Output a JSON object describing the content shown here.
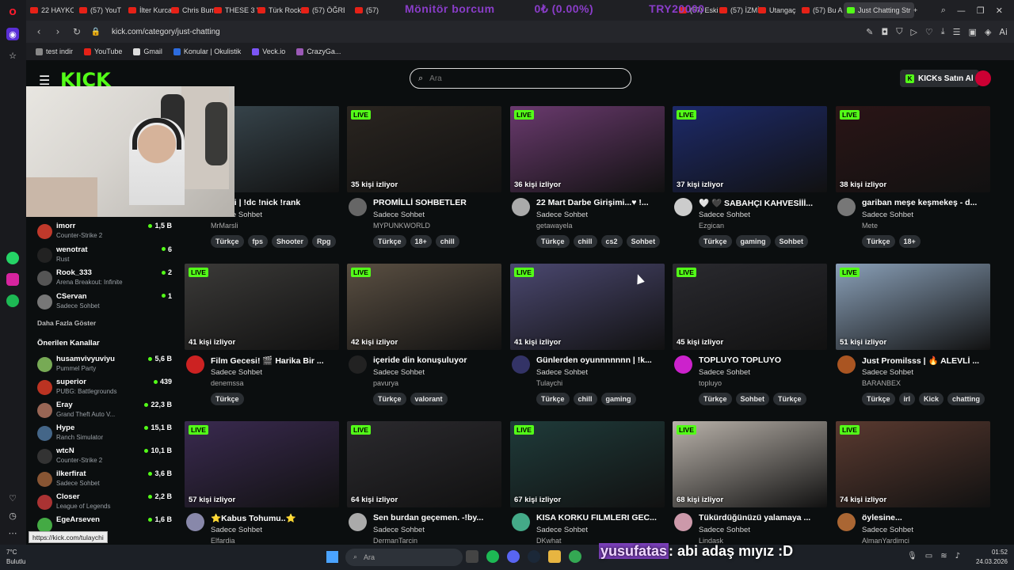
{
  "browser": {
    "tabs": [
      {
        "label": "22 HAYKO",
        "x": "38"
      },
      {
        "label": "(57) YouT",
        "x": "100"
      },
      {
        "label": "İlter Kurca",
        "x": "162"
      },
      {
        "label": "Chris Bum",
        "x": "216"
      },
      {
        "label": "THESE 3 V",
        "x": "270"
      },
      {
        "label": "Türk Rock",
        "x": "325"
      },
      {
        "label": "(57) ÖĞRE",
        "x": "380"
      },
      {
        "label": "(57)",
        "x": "448"
      },
      {
        "label": "(57) Eski S",
        "x": "857"
      },
      {
        "label": "(57) İZMİ",
        "x": "908"
      },
      {
        "label": "Utangaç",
        "x": "957"
      },
      {
        "label": "(57) Bu A",
        "x": "1012"
      },
      {
        "label": "Just Chatting Str",
        "x": "1065"
      }
    ],
    "ticker": {
      "label": "Mönitör borcum",
      "percent": "0₺ (0.00%)",
      "target": "TRY20000"
    },
    "url": "kick.com/category/just-chatting",
    "bookmarks": [
      "test indir",
      "YouTube",
      "Gmail",
      "Konular | Okulistik",
      "Veck.io",
      "CrazyGa..."
    ],
    "status_url": "https://kick.com/tulaychi"
  },
  "colors": {
    "accent": "#53fc18",
    "bg": "#0b0e0f",
    "tag_bg": "#2b2f33"
  },
  "header": {
    "logo": "KICK",
    "search_placeholder": "Ara",
    "buy_button": "KICKs Satın Al"
  },
  "sidebar": {
    "following": [
      {
        "name": "imorr",
        "game": "Counter-Strike 2",
        "viewers": "1,5 B",
        "color": "#c0392b"
      },
      {
        "name": "wenotrat",
        "game": "Rust",
        "viewers": "6",
        "color": "#222"
      },
      {
        "name": "Rook_333",
        "game": "Arena Breakout: Infinite",
        "viewers": "2",
        "color": "#555"
      },
      {
        "name": "CServan",
        "game": "Sadece Sohbet",
        "viewers": "1",
        "color": "#777"
      }
    ],
    "show_more": "Daha Fazla Göster",
    "recommended_title": "Önerilen Kanallar",
    "recommended": [
      {
        "name": "husamvivyuviyu",
        "game": "Pummel Party",
        "viewers": "5,6 B",
        "color": "#7a5"
      },
      {
        "name": "superior",
        "game": "PUBG: Battlegrounds",
        "viewers": "439",
        "color": "#b32"
      },
      {
        "name": "Eray",
        "game": "Grand Theft Auto V...",
        "viewers": "22,3 B",
        "color": "#965"
      },
      {
        "name": "Hype",
        "game": "Ranch Simulator",
        "viewers": "15,1 B",
        "color": "#468"
      },
      {
        "name": "wtcN",
        "game": "Counter-Strike 2",
        "viewers": "10,1 B",
        "color": "#333"
      },
      {
        "name": "ilkerfirat",
        "game": "Sadece Sohbet",
        "viewers": "3,6 B",
        "color": "#853"
      },
      {
        "name": "Closer",
        "game": "League of Legends",
        "viewers": "2,2 B",
        "color": "#a33"
      },
      {
        "name": "EgeArseven",
        "game": "",
        "viewers": "1,6 B",
        "color": "#4a4"
      }
    ]
  },
  "streams": [
    {
      "title": "neşesi | !dc !nick !rank",
      "category": "Sadece Sohbet",
      "user": "MrMarsli",
      "viewers": "",
      "tags": [
        "Türkçe",
        "fps",
        "Shooter",
        "Rpg"
      ],
      "thumb": "#3b4a52",
      "av": "#555"
    },
    {
      "title": "PROMİLLİ SOHBETLER",
      "category": "Sadece Sohbet",
      "user": "MYPUNKWORLD",
      "viewers": "35 kişi izliyor",
      "tags": [
        "Türkçe",
        "18+",
        "chill"
      ],
      "thumb": "#2a2520",
      "av": "#666"
    },
    {
      "title": "22 Mart Darbe Girişimi...♥ !...",
      "category": "Sadece Sohbet",
      "user": "getawayela",
      "viewers": "36 kişi izliyor",
      "tags": [
        "Türkçe",
        "chill",
        "cs2",
        "Sohbet"
      ],
      "thumb": "#6a3a6e",
      "av": "#aaa"
    },
    {
      "title": "🤍 🖤 SABAHÇI KAHVESİİİ...",
      "category": "Sadece Sohbet",
      "user": "Ezgican",
      "viewers": "37 kişi izliyor",
      "tags": [
        "Türkçe",
        "gaming",
        "Sohbet"
      ],
      "thumb": "#1d2a6a",
      "av": "#ccc"
    },
    {
      "title": "gariban meşe keşmekeş - d...",
      "category": "Sadece Sohbet",
      "user": "Mete",
      "viewers": "38 kişi izliyor",
      "tags": [
        "Türkçe",
        "18+"
      ],
      "thumb": "#2a1516",
      "av": "#777"
    },
    {
      "title": "Film Gecesi! 🎬 Harika Bir ...",
      "category": "Sadece Sohbet",
      "user": "denemssa",
      "viewers": "41 kişi izliyor",
      "tags": [
        "Türkçe"
      ],
      "thumb": "#3b3a38",
      "av": "#c22"
    },
    {
      "title": "içeride din konuşuluyor",
      "category": "Sadece Sohbet",
      "user": "pavurya",
      "viewers": "42 kişi izliyor",
      "tags": [
        "Türkçe",
        "valorant"
      ],
      "thumb": "#5a4f42",
      "av": "#222"
    },
    {
      "title": "Günlerden oyunnnnnnn | !k...",
      "category": "Sadece Sohbet",
      "user": "Tulaychi",
      "viewers": "41 kişi izliyor",
      "tags": [
        "Türkçe",
        "chill",
        "gaming"
      ],
      "thumb": "#4b4870",
      "av": "#336"
    },
    {
      "title": "TOPLUYO TOPLUYO",
      "category": "Sadece Sohbet",
      "user": "topluyo",
      "viewers": "45 kişi izliyor",
      "tags": [
        "Türkçe",
        "Sohbet",
        "Türkçe"
      ],
      "thumb": "#2a2a2f",
      "av": "#c2c"
    },
    {
      "title": "Just Promilsss | 🔥 ALEVLİ ...",
      "category": "Sadece Sohbet",
      "user": "BARANBEX",
      "viewers": "51 kişi izliyor",
      "tags": [
        "Türkçe",
        "irl",
        "Kick",
        "chatting"
      ],
      "thumb": "#8aa0b8",
      "av": "#a52"
    },
    {
      "title": "⭐Kabus Tohumu..⭐",
      "category": "Sadece Sohbet",
      "user": "Elfardia",
      "viewers": "57 kişi izliyor",
      "tags": [],
      "thumb": "#3a2a50",
      "av": "#88a"
    },
    {
      "title": "Sen burdan geçemen. -!by...",
      "category": "Sadece Sohbet",
      "user": "DermanTarcin",
      "viewers": "64 kişi izliyor",
      "tags": [],
      "thumb": "#2b2a2e",
      "av": "#aaa"
    },
    {
      "title": "KISA KORKU FILMLERI GEC...",
      "category": "Sadece Sohbet",
      "user": "DKwhat",
      "viewers": "67 kişi izliyor",
      "tags": [],
      "thumb": "#1f3b3a",
      "av": "#4a8"
    },
    {
      "title": "Tükürdüğünüzü yalamaya ...",
      "category": "Sadece Sohbet",
      "user": "Lindask",
      "viewers": "68 kişi izliyor",
      "tags": [],
      "thumb": "#b9b2aa",
      "av": "#c9a"
    },
    {
      "title": "öylesine...",
      "category": "Sadece Sohbet",
      "user": "AlmanYardimci",
      "viewers": "74 kişi izliyor",
      "tags": [],
      "thumb": "#5a3a30",
      "av": "#a63"
    }
  ],
  "live_label": "LIVE",
  "taskbar": {
    "weather_temp": "7°C",
    "weather_desc": "Bulutlu",
    "search": "Ara",
    "time": "01:52",
    "date": "24.03.2026",
    "chat_user": "yusufatas",
    "chat_msg": ": abi adaş mıyız :D"
  }
}
